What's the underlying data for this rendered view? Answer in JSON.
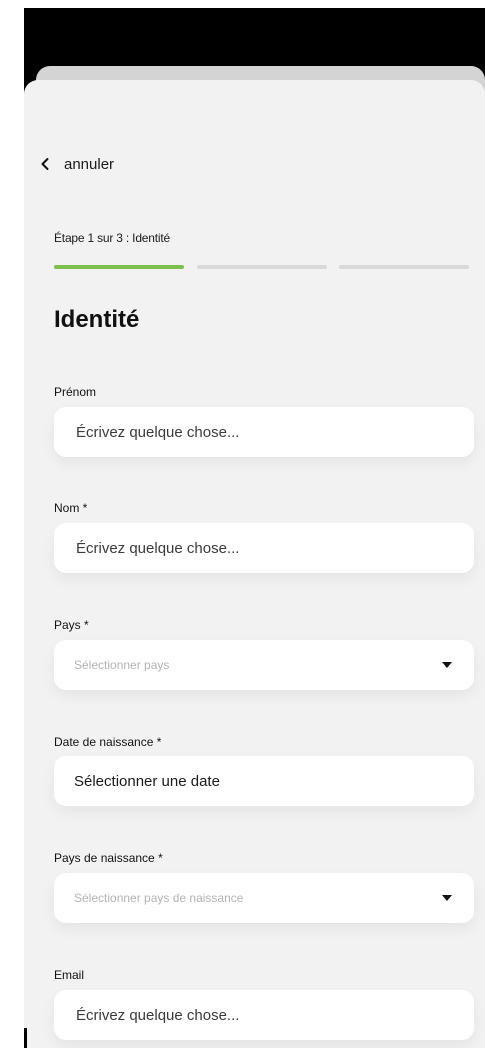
{
  "header": {
    "cancel_label": "annuler",
    "step_label": "Étape 1 sur 3 : Identité",
    "steps": [
      {
        "state": "complete",
        "color": "#7cc04b"
      },
      {
        "state": "pending",
        "color": "#d9d9d9"
      },
      {
        "state": "pending",
        "color": "#d9d9d9"
      }
    ]
  },
  "section": {
    "title": "Identité"
  },
  "form": {
    "first_name": {
      "label": "Prénom",
      "placeholder": "Écrivez quelque chose..."
    },
    "last_name": {
      "label": "Nom *",
      "placeholder": "Écrivez quelque chose..."
    },
    "country": {
      "label": "Pays *",
      "placeholder": "Sélectionner pays"
    },
    "birth_date": {
      "label": "Date de naissance *",
      "value": "Sélectionner une date"
    },
    "birth_country": {
      "label": "Pays de naissance *",
      "placeholder": "Sélectionner pays de naissance"
    },
    "email": {
      "label": "Email",
      "placeholder": "Écrivez quelque chose..."
    }
  },
  "icons": {
    "back": "chevron-left-icon",
    "dropdown": "caret-down-icon"
  }
}
